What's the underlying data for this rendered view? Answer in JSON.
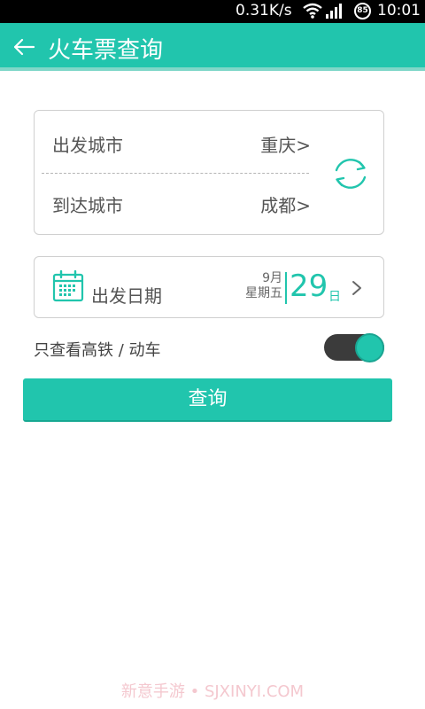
{
  "status_bar": {
    "net_speed": "0.31K/s",
    "battery": "85",
    "time": "10:01"
  },
  "header": {
    "title": "火车票查询",
    "back_icon": "arrow-left-icon",
    "bg_color": "#21c5ad"
  },
  "route": {
    "depart_label": "出发城市",
    "depart_city": "重庆>",
    "arrive_label": "到达城市",
    "arrive_city": "成都>",
    "swap_icon": "swap-arrows-icon"
  },
  "date": {
    "label": "出发日期",
    "month": "9月",
    "weekday": "星期五",
    "day": "29",
    "day_unit": "日",
    "icon": "calendar-icon"
  },
  "filter": {
    "label": "只查看高铁 / 动车",
    "enabled": true
  },
  "actions": {
    "query_label": "查询"
  },
  "watermark": "新意手游 • SJXINYI.COM",
  "colors": {
    "accent": "#21c5ad",
    "toggle_track": "#3b3b3b"
  }
}
